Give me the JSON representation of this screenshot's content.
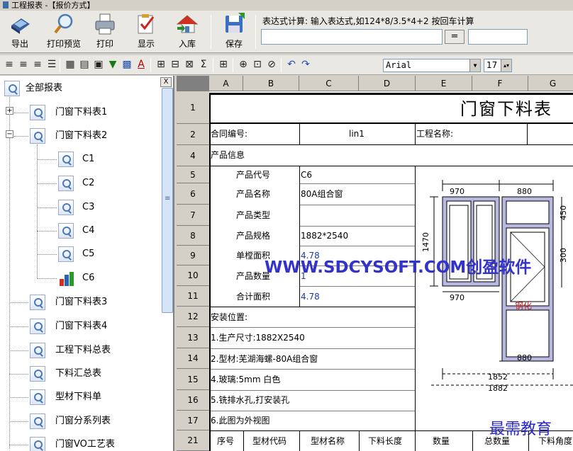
{
  "window": {
    "title": "工程报表 -【报价方式】"
  },
  "toolbar": {
    "buttons": [
      {
        "id": "export",
        "label": "导出"
      },
      {
        "id": "print_preview",
        "label": "打印预览"
      },
      {
        "id": "print",
        "label": "打印"
      },
      {
        "id": "display",
        "label": "显示"
      },
      {
        "id": "import",
        "label": "入库"
      },
      {
        "id": "save",
        "label": "保存"
      }
    ],
    "expr_label": "表达式计算: 输入表达式,如124*8/3.5*4+2 按回车计算",
    "expr_value": "",
    "equals_label": "=",
    "result_value": ""
  },
  "format_bar": {
    "font": "Arial",
    "size": "17"
  },
  "tree": {
    "close_label": "X",
    "root": "全部报表",
    "items": [
      "门窗下料表1",
      "门窗下料表2",
      "C1",
      "C2",
      "C3",
      "C4",
      "C5",
      "C6",
      "门窗下料表3",
      "门窗下料表4",
      "工程下料总表",
      "下料汇总表",
      "型材下料单",
      "门窗分系列表",
      "门窗VO工艺表"
    ]
  },
  "sheet": {
    "columns": [
      "A",
      "B",
      "C",
      "D",
      "E",
      "F",
      "G"
    ],
    "rows": [
      "1",
      "2",
      "4",
      "5",
      "6",
      "7",
      "8",
      "9",
      "10",
      "11",
      "12",
      "13",
      "14",
      "15",
      "16",
      "17",
      "21"
    ],
    "title": "门窗下料表",
    "contract_label": "合同编号:",
    "contract_value": "lin1",
    "project_label": "工程名称:",
    "product_info": "产品信息",
    "fields": [
      {
        "label": "产品代号",
        "value": "C6"
      },
      {
        "label": "产品名称",
        "value": "80A组合窗"
      },
      {
        "label": "产品类型",
        "value": ""
      },
      {
        "label": "产品规格",
        "value": "1882*2540"
      },
      {
        "label": "单樘面积",
        "value": "4.78"
      },
      {
        "label": "产品数量",
        "value": "1"
      },
      {
        "label": "合计面积",
        "value": "4.78"
      }
    ],
    "install": "安装位置:",
    "notes": [
      "1.生产尺寸:1882X2540",
      "2.型材:芜湖海螺-80A组合窗",
      "4.玻璃:5mm 白色",
      "5.铣排水孔,打安装孔",
      "6.此图为外视图"
    ],
    "table_headers": [
      "序号",
      "型材代码",
      "型材名称",
      "下料长度",
      "数量",
      "总数量",
      "下料角度"
    ],
    "watermark": "WWW.SDCYSOFT.COM创盈软件",
    "watermark2": "最需教育",
    "drawing": {
      "dims": [
        "970",
        "880",
        "970",
        "880",
        "1852",
        "1882",
        "1470",
        "450",
        "300"
      ],
      "label": "钢化"
    }
  }
}
